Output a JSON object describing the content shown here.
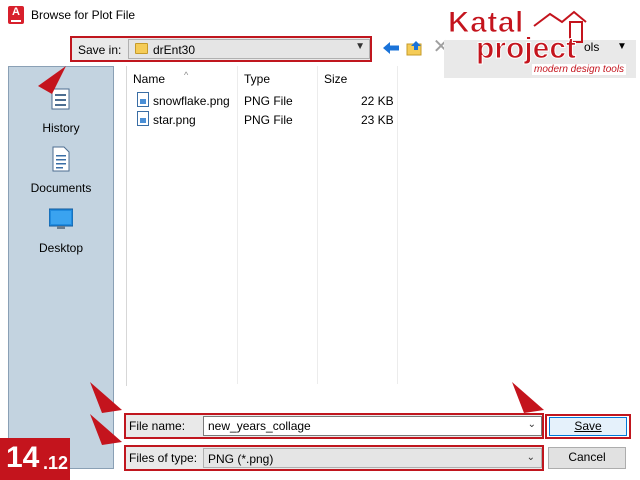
{
  "window": {
    "title": "Browse for Plot File"
  },
  "toolbar": {
    "save_in_label": "Save in:",
    "save_in_value": "drEnt30",
    "tools_label": "ols"
  },
  "places": [
    {
      "label": "History",
      "icon": "history-icon"
    },
    {
      "label": "Documents",
      "icon": "documents-icon"
    },
    {
      "label": "Desktop",
      "icon": "desktop-icon"
    }
  ],
  "file_list": {
    "columns": [
      "Name",
      "Type",
      "Size"
    ],
    "rows": [
      {
        "name": "snowflake.png",
        "type": "PNG File",
        "size": "22 KB"
      },
      {
        "name": "star.png",
        "type": "PNG File",
        "size": "23 KB"
      }
    ]
  },
  "form": {
    "file_name_label": "File name:",
    "file_name_value": "new_years_collage",
    "files_of_type_label": "Files of type:",
    "files_of_type_value": "PNG (*.png)",
    "save_label": "Save",
    "cancel_label": "Cancel"
  },
  "overlay": {
    "version_major": "14",
    "version_minor": ".12",
    "logo_line1": "Katal",
    "logo_line2": "project",
    "logo_tagline": "modern design tools"
  },
  "colors": {
    "accent_red": "#c4141d",
    "places_bg": "#c3d3e0",
    "focus_blue": "#0078d7"
  }
}
